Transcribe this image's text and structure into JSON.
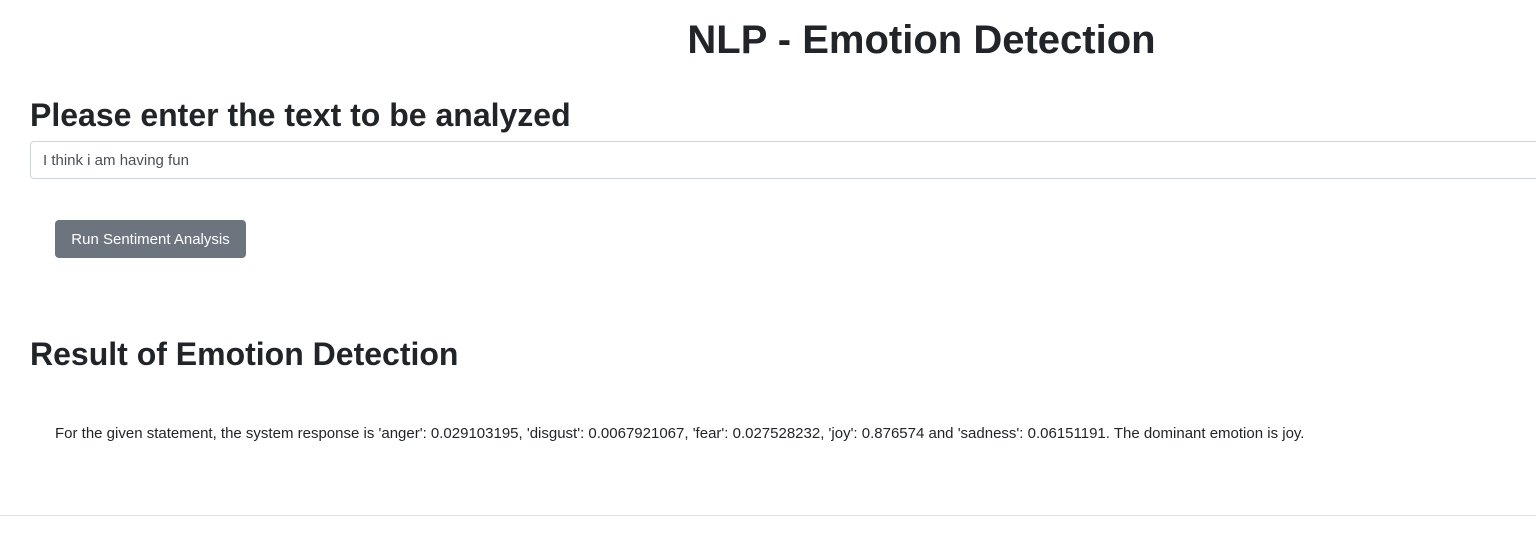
{
  "header": {
    "title": "NLP - Emotion Detection"
  },
  "form": {
    "heading": "Please enter the text to be analyzed",
    "input_value": "I think i am having fun",
    "button_label": "Run Sentiment Analysis"
  },
  "result": {
    "heading": "Result of Emotion Detection",
    "text": "For the given statement, the system response is 'anger': 0.029103195, 'disgust': 0.0067921067, 'fear': 0.027528232, 'joy': 0.876574 and 'sadness': 0.06151191. The dominant emotion is joy."
  },
  "colors": {
    "button_background": "#6c757d",
    "button_text": "#ffffff",
    "heading_text": "#212529",
    "input_border": "#ced4da"
  }
}
